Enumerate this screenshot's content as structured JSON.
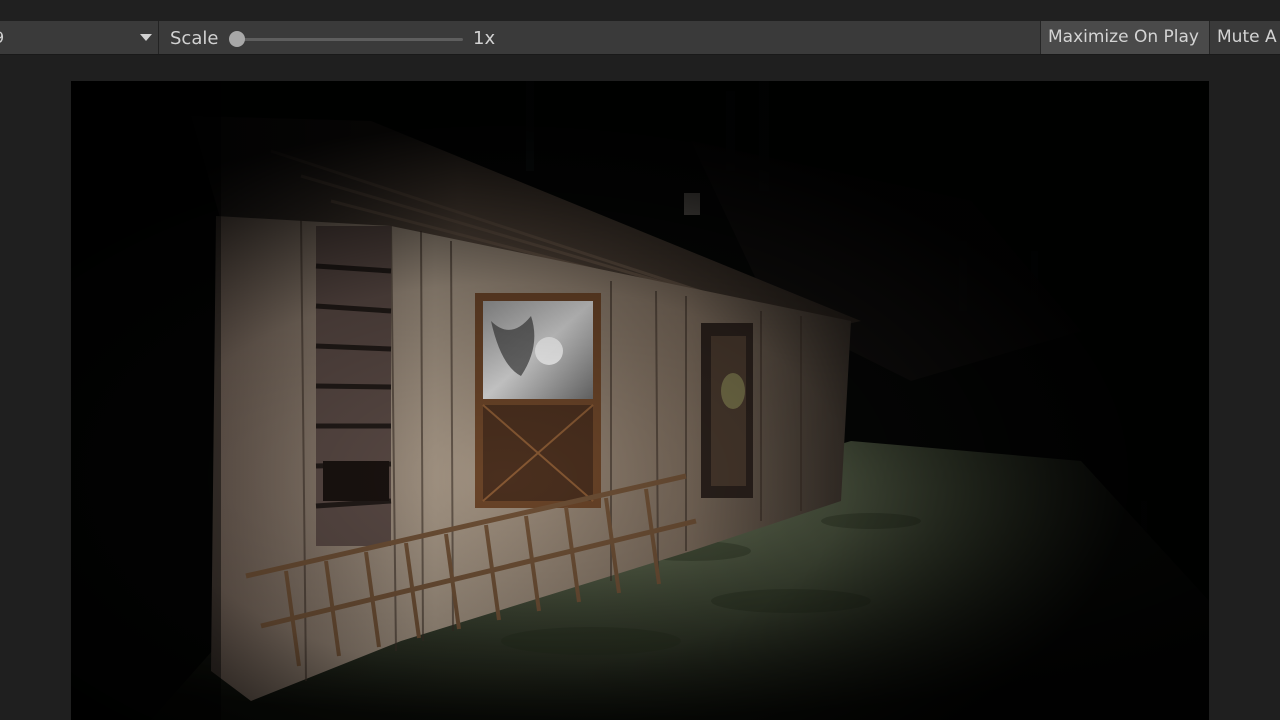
{
  "toolbar": {
    "display_dropdown": {
      "visible_text": "9",
      "caret_icon": "caret-down-icon"
    },
    "scale": {
      "label": "Scale",
      "value": "1x",
      "slider_fraction": 0.0
    },
    "buttons": {
      "maximize_on_play": "Maximize On Play",
      "mute_audio": "Mute A"
    }
  },
  "colors": {
    "toolbar_bg": "#3a3a3a",
    "button_active_bg": "#4a4a4a",
    "editor_bg": "#1f1f1f",
    "game_bg": "#050505"
  },
  "game_view": {
    "scene": "dark-forest-cabin-flashlight"
  }
}
